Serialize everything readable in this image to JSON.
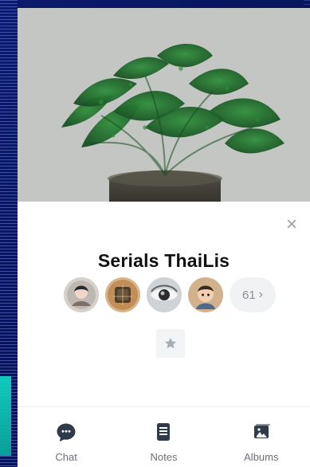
{
  "group": {
    "title": "Serials ThaiLis"
  },
  "members": {
    "count_label": "61",
    "chevron": "›",
    "avatars": [
      {
        "name": "avatar-1"
      },
      {
        "name": "avatar-2"
      },
      {
        "name": "avatar-3"
      },
      {
        "name": "avatar-4"
      }
    ]
  },
  "actions": {
    "close_glyph": "×"
  },
  "bottom_nav": {
    "items": [
      {
        "label": "Chat",
        "icon": "chat-icon"
      },
      {
        "label": "Notes",
        "icon": "notes-icon"
      },
      {
        "label": "Albums",
        "icon": "albums-icon"
      }
    ]
  },
  "colors": {
    "nav_icon": "#2f3a4a",
    "muted_text": "#6c7077",
    "divider": "#f0f1f3",
    "pill_bg": "#f1f2f4",
    "fav_bg": "#f3f4f6",
    "star": "#a7adb6"
  }
}
